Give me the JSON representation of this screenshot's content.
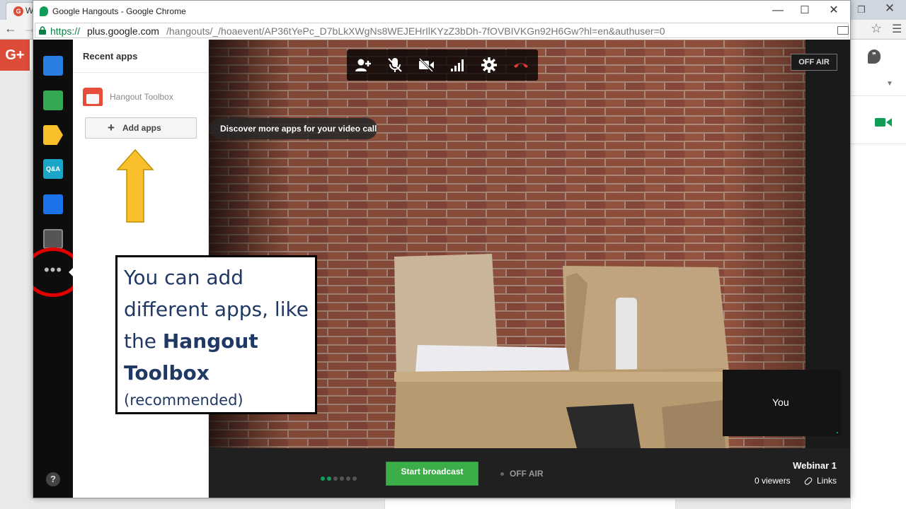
{
  "background_browser": {
    "tab_label": "W",
    "gplus_logo": "G+"
  },
  "popup": {
    "window_title": "Google Hangouts - Google Chrome",
    "url_scheme": "https://",
    "url_host": "plus.google.com",
    "url_path": "/hangouts/_/hoaevent/AP36tYePc_D7bLkXWgNs8WEJEHrIlKYzZ3bDh-7fOVBIVKGn92H6Gw?hl=en&authuser=0"
  },
  "apps_panel": {
    "header": "Recent apps",
    "recent_app": "Hangout Toolbox",
    "add_apps_label": "Add apps"
  },
  "video": {
    "off_air_badge": "OFF AIR",
    "tooltip": "Discover more apps for your video call",
    "self_view_label": "You"
  },
  "callout": {
    "text_part1": "You can add different apps, like the ",
    "text_bold": "Hangout Toolbox",
    "text_note": "(recommended)"
  },
  "bottom_bar": {
    "start_broadcast": "Start broadcast",
    "off_air": "OFF AIR",
    "webinar_title": "Webinar 1",
    "viewers": "0 viewers",
    "links": "Links",
    "progress_steps_total": 6,
    "progress_steps_done": 2
  },
  "colors": {
    "accent_green": "#3cae49",
    "annotation_red": "#e00000",
    "arrow_yellow": "#f9c02b",
    "callout_text": "#1f3864",
    "brick": "#8f4f3c"
  }
}
